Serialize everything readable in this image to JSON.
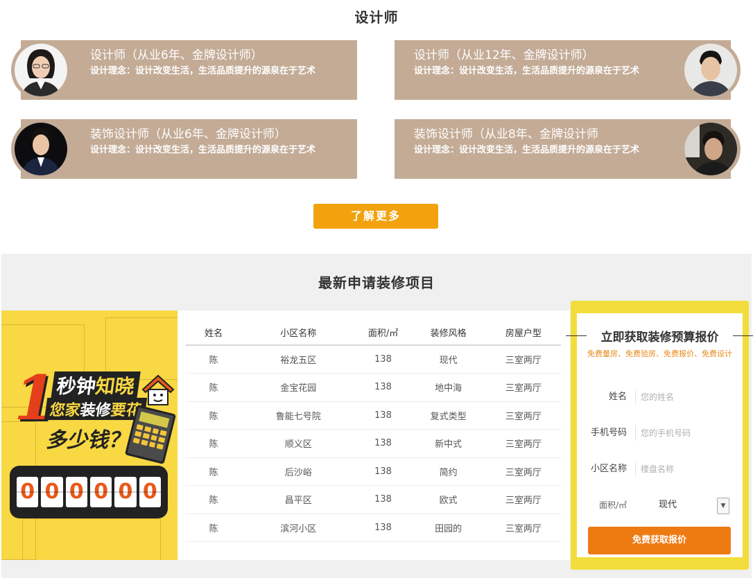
{
  "designers": {
    "title": "设计师",
    "cards": [
      {
        "name": "设计师（从业6年、金牌设计师）",
        "idea": "设计理念：设计改变生活，生活品质提升的源泉在于艺术"
      },
      {
        "name": "设计师（从业12年、金牌设计师）",
        "idea": "设计理念：设计改变生活，生活品质提升的源泉在于艺术"
      },
      {
        "name": "装饰设计师（从业6年、金牌设计师）",
        "idea": "设计理念：设计改变生活，生活品质提升的源泉在于艺术"
      },
      {
        "name": "装饰设计师（从业8年、金牌设计师",
        "idea": "设计理念：设计改变生活，生活品质提升的源泉在于艺术"
      }
    ],
    "more_label": "了解更多"
  },
  "projects": {
    "title": "最新申请装修项目",
    "promo": {
      "big_digit": "1",
      "line1_a": "秒钟",
      "line1_b": "知晓",
      "line2_a": "您家",
      "line2_b": "装修",
      "line2_c": "要花",
      "line3": "多少钱？",
      "counter": [
        "0",
        "0",
        "0",
        "0",
        "0",
        "0"
      ]
    },
    "table": {
      "headers": [
        "姓名",
        "小区名称",
        "面积/㎡",
        "装修风格",
        "房屋户型"
      ],
      "rows": [
        [
          "陈",
          "裕龙五区",
          "138",
          "现代",
          "三室两厅"
        ],
        [
          "陈",
          "金宝花园",
          "138",
          "地中海",
          "三室两厅"
        ],
        [
          "陈",
          "鲁能七号院",
          "138",
          "复式类型",
          "三室两厅"
        ],
        [
          "陈",
          "顺义区",
          "138",
          "新中式",
          "三室两厅"
        ],
        [
          "陈",
          "后沙峪",
          "138",
          "简约",
          "三室两厅"
        ],
        [
          "陈",
          "昌平区",
          "138",
          "欧式",
          "三室两厅"
        ],
        [
          "陈",
          "滨河小区",
          "138",
          "田园的",
          "三室两厅"
        ]
      ]
    }
  },
  "quote_form": {
    "title": "立即获取装修预算报价",
    "subtitle": "免费量房、免费验房、免费报价、免费设计",
    "name_label": "姓名",
    "name_placeholder": "您的姓名",
    "phone_label": "手机号码",
    "phone_placeholder": "您的手机号码",
    "community_label": "小区名称",
    "community_placeholder": "楼盘名称",
    "area_label": "面积/㎡",
    "style_selected": "现代",
    "submit_label": "免费获取报价",
    "colors": {
      "accent": "#ee7b12",
      "frame": "#f2dd3c",
      "card": "#c3ab96",
      "more_button": "#f2a20d"
    }
  }
}
